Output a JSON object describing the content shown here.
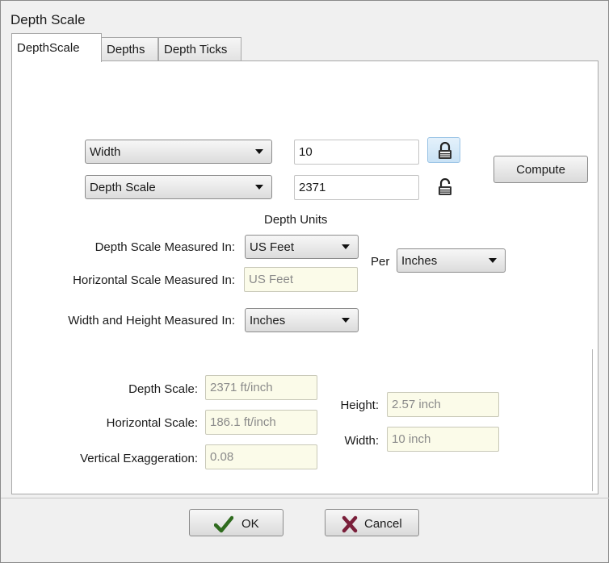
{
  "window": {
    "title": "Depth Scale"
  },
  "tabs": [
    {
      "label": "DepthScale",
      "active": true
    },
    {
      "label": "Depths",
      "active": false
    },
    {
      "label": "Depth Ticks",
      "active": false
    }
  ],
  "scale_row1": {
    "selector": "Width",
    "value": "10",
    "lock_state": "locked"
  },
  "scale_row2": {
    "selector": "Depth Scale",
    "value": "2371",
    "lock_state": "unlocked"
  },
  "compute_label": "Compute",
  "units": {
    "heading": "Depth Units",
    "depth_measured_label": "Depth Scale Measured In:",
    "depth_measured_value": "US Feet",
    "horizontal_measured_label": "Horizontal Scale Measured In:",
    "horizontal_measured_value": "US Feet",
    "per_label": "Per",
    "per_value": "Inches",
    "wh_measured_label": "Width and Height Measured In:",
    "wh_measured_value": "Inches"
  },
  "results": {
    "depth_scale_label": "Depth Scale:",
    "depth_scale_value": "2371 ft/inch",
    "horizontal_scale_label": "Horizontal Scale:",
    "horizontal_scale_value": "186.1 ft/inch",
    "vertical_exag_label": "Vertical Exaggeration:",
    "vertical_exag_value": "0.08",
    "height_label": "Height:",
    "height_value": "2.57 inch",
    "width_label": "Width:",
    "width_value": "10 inch"
  },
  "buttons": {
    "ok_label": "OK",
    "cancel_label": "Cancel"
  },
  "colors": {
    "ok_check": "#2f6b1e",
    "cancel_x": "#7a1f3a",
    "readonly_bg": "#fbfbe9"
  }
}
